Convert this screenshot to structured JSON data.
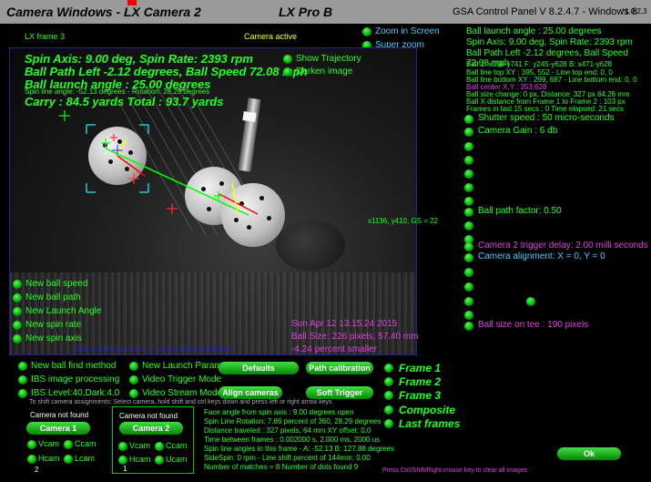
{
  "titlebar": {
    "left": "Camera Windows - LX Camera 2",
    "center": "LX Pro B",
    "right": "GSA Control Panel V 8.2.4.7 - Windows 8",
    "version": "*1,0,2,3"
  },
  "frame": {
    "label": "LX frame 3",
    "camera_status": "Camera active",
    "zoom_in_screen": "Zoom in Screen",
    "super_zoom": "Super zoom",
    "show_trajectory": "Show Trajectory",
    "darken_image": "Darken image",
    "spin_axis_line": "Spin Axis: 9.00 deg, Spin Rate: 2393 rpm",
    "ball_path_line": "Ball Path Left -2.12 degrees, Ball Speed 72.08 mph",
    "launch_line": "Ball launch angle : 25.00 degrees",
    "spin_line_small": "Spin line angle: -52.13 degrees - Rotation: 28.29 degrees",
    "carry_line": "Carry : 84.5 yards  Total : 93.7 yards",
    "coord_readout": "x1136, y410, GS = 22",
    "timestamp": "Sun Apr 12 13.15.24 2015",
    "ball_size": "Ball Size: 226 pixels, 57.40 mm",
    "percent_smaller": "-4.24 percent smaller",
    "hint": "Click on border to move - F7 to store image to clipboard",
    "left_options": [
      "New ball speed",
      "New ball path",
      "New Launch Angle",
      "New spin rate",
      "New spin axis"
    ]
  },
  "right_panel": {
    "launch": "Ball launch angle : 25.00 degrees",
    "spin_axis": "Spin Axis: 9.00 deg, Spin Rate: 2393 rpm",
    "ball_path": "Ball Path Left -2.12 degrees, Ball Speed 72.08 mph",
    "ball1": "Ball 1: x358-y741 F: y245-y628 B: x471-y628",
    "ball_line_top": "Ball line top XY : 395, 552 - Line top end: 0, 0",
    "ball_line_bottom": "Ball line bottom XY : 299, 687 - Line bottom end: 0, 0",
    "ball_center": "Ball center X,Y : 353,628",
    "ball_size_change": "Ball size change: 0 px, Distance: 327 px 64.26 mm",
    "x_distance": "Ball X distance from Frame 1 to Frame 2 : 103 px",
    "frames_last": "Frames in last 15 secs : 0 Time elapsed: 21 secs",
    "shutter_speed": "Shutter speed : 50 micro-seconds",
    "camera_gain": "Camera Gain : 6 db",
    "ball_path_factor": "Ball path factor: 0.50",
    "trigger_delay": "Camera 2 trigger delay: 2.00 milli seconds",
    "alignment": "Camera alignment: X = 0, Y = 0",
    "ball_size_tee": "Ball size on tee : 190 pixels",
    "ok_label": "Ok",
    "footer_hint": "Press Ctrl/Shift/Right mouse key to clear all images"
  },
  "bottom": {
    "opt_new_ball_find": "New ball find method",
    "opt_new_launch_params": "New Launch Params",
    "opt_ibs_processing": "IBS image processing",
    "opt_video_trigger": "Video Trigger Mode",
    "opt_ibs_level": "IBS Level:40,Dark:4.0",
    "opt_video_stream": "Video Stream Mode",
    "btn_defaults": "Defaults",
    "btn_path_calibration": "Path calibration",
    "btn_align_cameras": "Align cameras",
    "btn_soft_trigger": "Soft Trigger",
    "frames": [
      "Frame 1",
      "Frame 2",
      "Frame 3",
      "Composite",
      "Last frames"
    ],
    "shift_hint": "To shift camera assignments: Select camera, hold shift and ctrl keys down and press left or right arrow keys",
    "cam1": {
      "status": "Camera not found",
      "button": "Camera 1",
      "vcam": "Vcam",
      "ccam": "Ccam",
      "hcam": "Hcam",
      "lcam": "Lcam",
      "index": "2"
    },
    "cam2": {
      "status": "Camera not found",
      "button": "Camera 2",
      "vcam": "Vcam",
      "ccam": "Ccam",
      "hcam": "Hcam",
      "ucam": "Ucam",
      "index": "1"
    },
    "info_lines": [
      "Face angle from spin axis : 9.00 degrees open",
      "Spin Line Rotation: 7.86 percent of 360, 28.29 degrees",
      "Distance traveled : 327 pixels, 64 mm  XY offset: 0,0",
      "Time between frames : 0.002000 s, 2.000 ms, 2000 us",
      "Spin line angles in this frame - A: -52.13  B: 127.88 degrees",
      "SideSpin: 0 rpm - Line shift percent of 144mm: 0.00",
      "Number of matches = 8 Number of dots found 9"
    ]
  }
}
